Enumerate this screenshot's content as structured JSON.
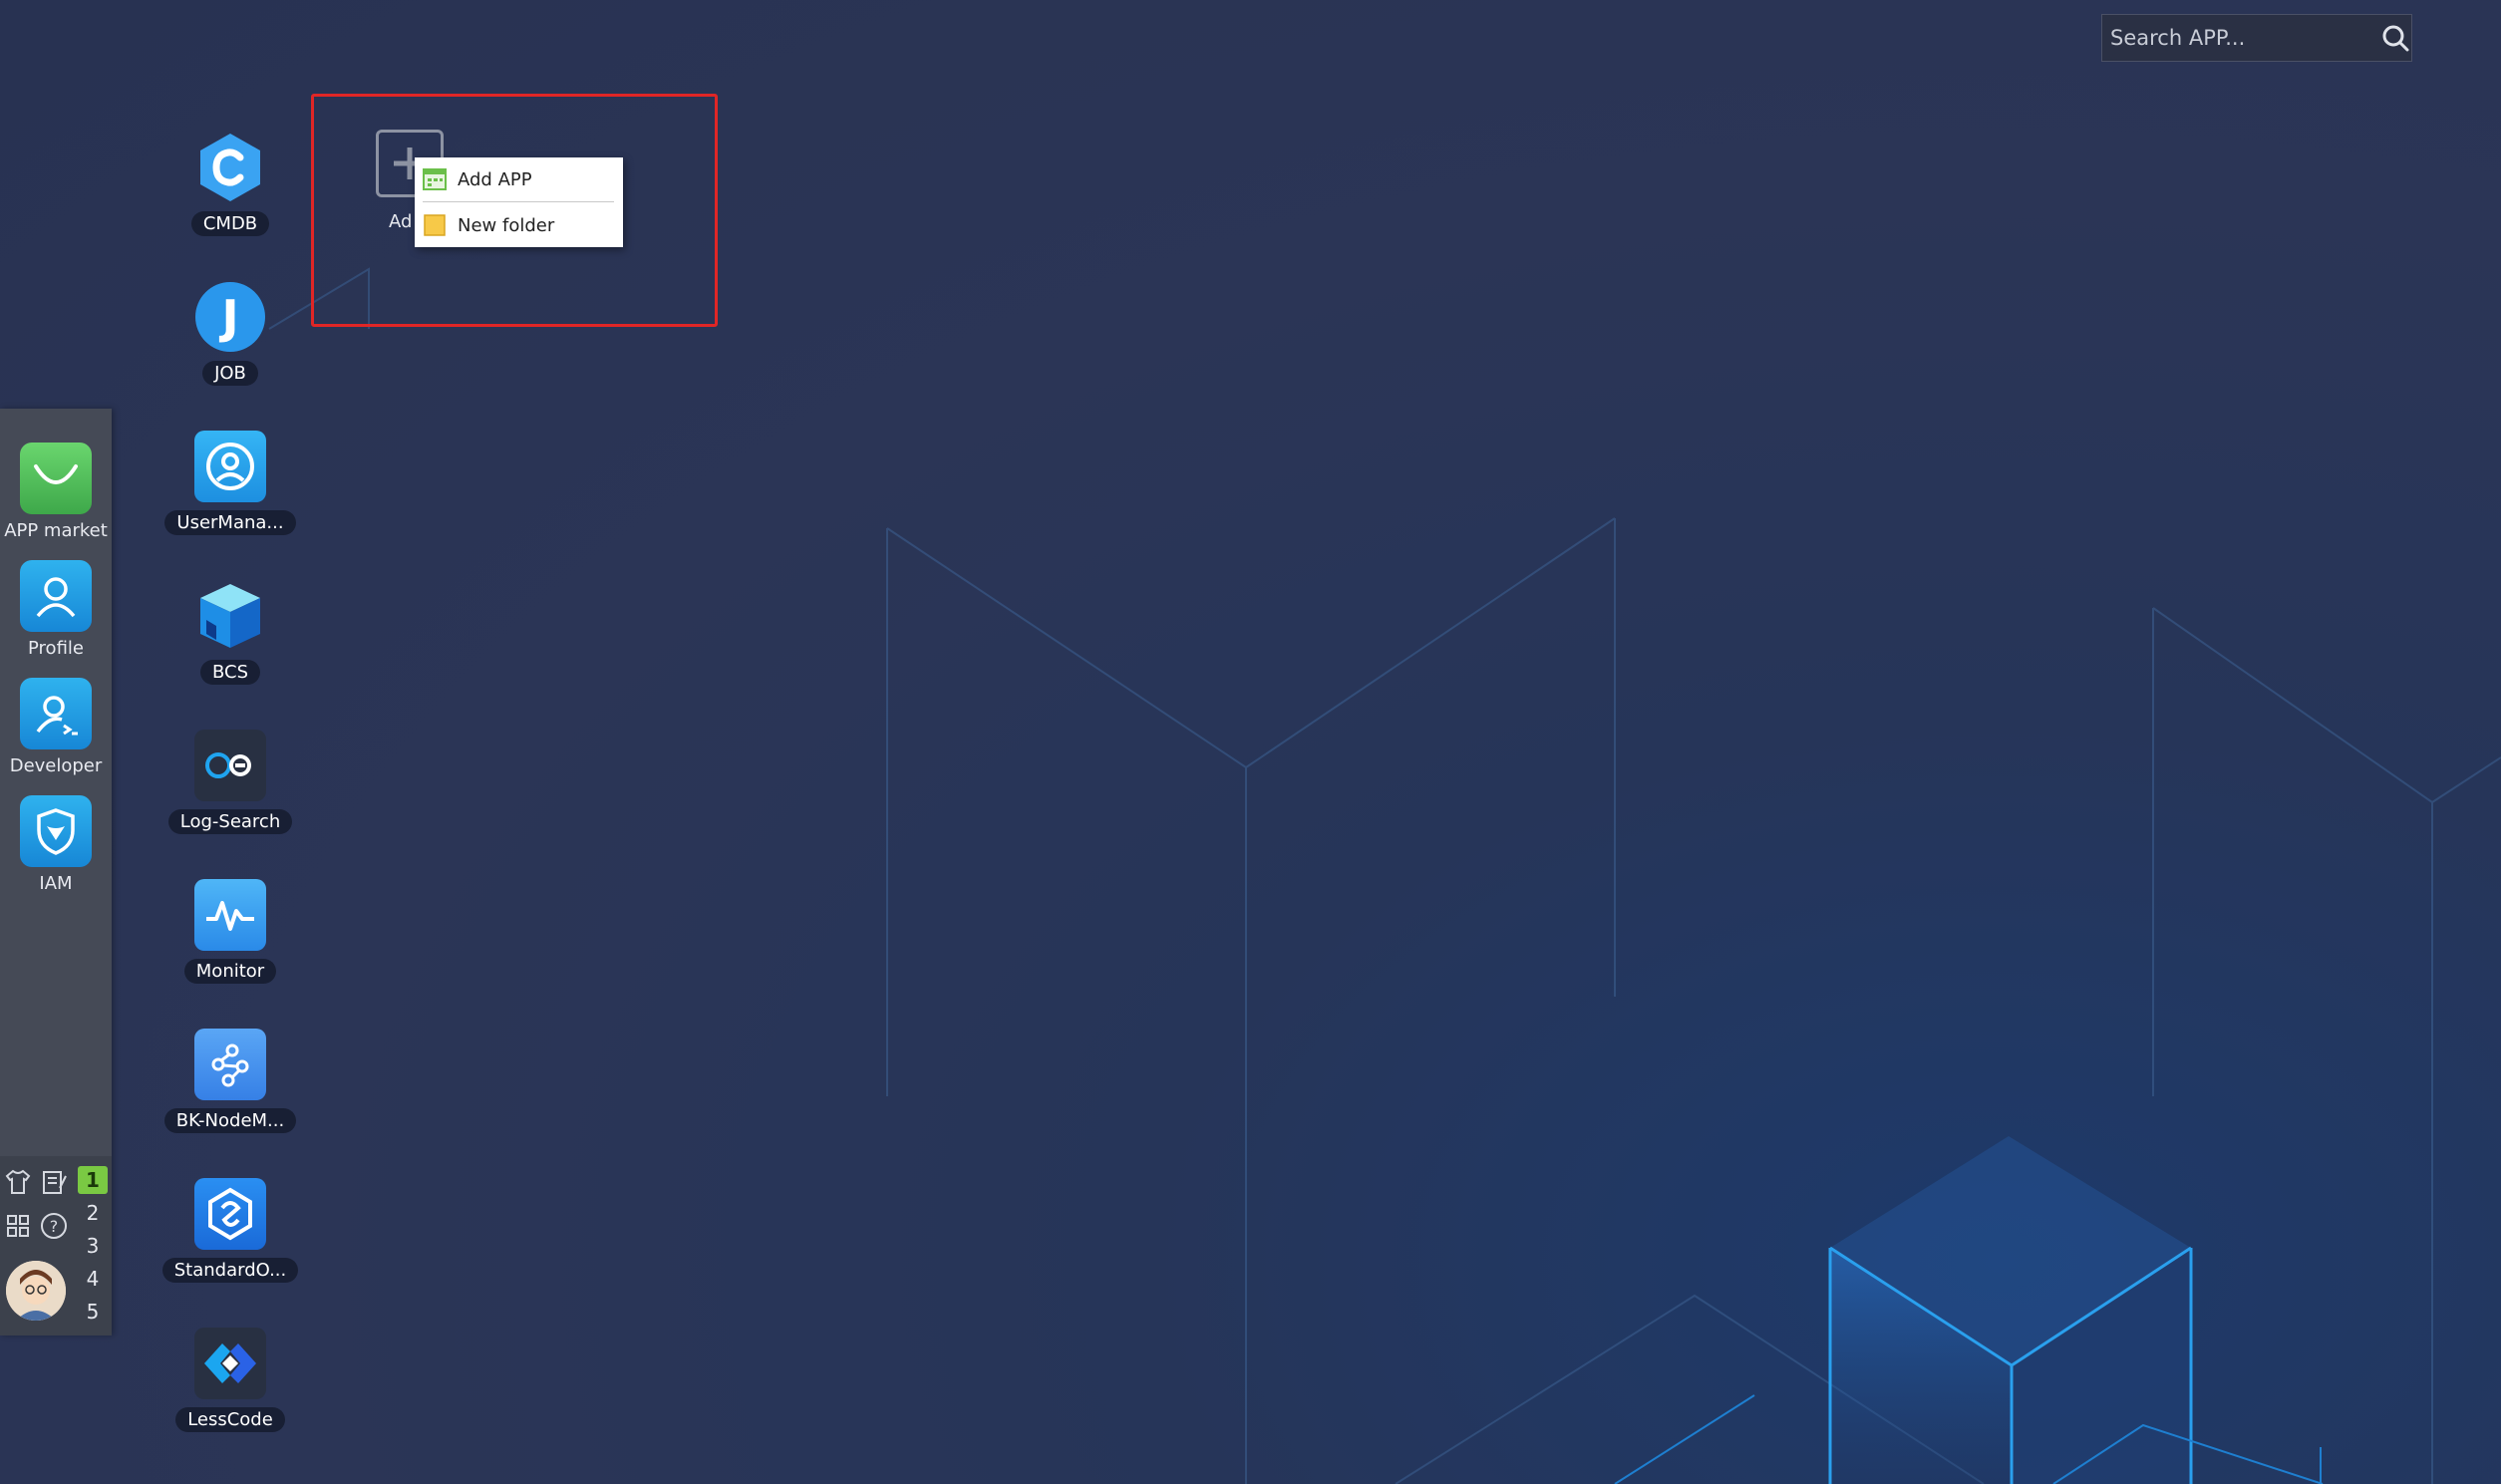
{
  "search": {
    "placeholder": "Search APP..."
  },
  "dock": {
    "items": [
      {
        "label": "APP market",
        "icon": "shopping-bag-icon",
        "color": "#4cb85a"
      },
      {
        "label": "Profile",
        "icon": "user-icon",
        "color": "#1a9fe0"
      },
      {
        "label": "Developer",
        "icon": "developer-icon",
        "color": "#1a9fe0"
      },
      {
        "label": "IAM",
        "icon": "shield-icon",
        "color": "#1a9fe0"
      }
    ],
    "workspaces": [
      "1",
      "2",
      "3",
      "4",
      "5"
    ],
    "active_workspace": "1"
  },
  "apps": [
    {
      "label": "CMDB",
      "icon": "cmdb-icon"
    },
    {
      "label": "JOB",
      "icon": "job-icon"
    },
    {
      "label": "UserMana...",
      "icon": "user-manager-icon"
    },
    {
      "label": "BCS",
      "icon": "bcs-cube-icon"
    },
    {
      "label": "Log-Search",
      "icon": "log-search-icon"
    },
    {
      "label": "Monitor",
      "icon": "monitor-icon"
    },
    {
      "label": "BK-NodeM...",
      "icon": "node-manager-icon"
    },
    {
      "label": "StandardO...",
      "icon": "standard-ops-icon"
    },
    {
      "label": "LessCode",
      "icon": "lesscode-icon"
    }
  ],
  "add_tile": {
    "label": "Ad"
  },
  "context_menu": {
    "items": [
      {
        "label": "Add APP"
      },
      {
        "label": "New folder"
      }
    ]
  },
  "colors": {
    "accent": "#1a9fe0",
    "highlight": "#e02626",
    "active_workspace": "#7ac943"
  }
}
